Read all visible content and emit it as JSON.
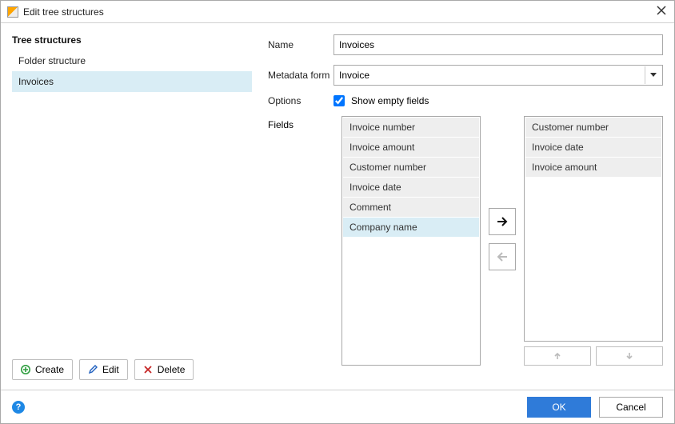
{
  "title": "Edit tree structures",
  "left": {
    "heading": "Tree structures",
    "items": [
      "Folder structure",
      "Invoices"
    ],
    "selected_index": 1,
    "buttons": {
      "create": "Create",
      "edit": "Edit",
      "delete": "Delete"
    }
  },
  "form": {
    "name_label": "Name",
    "name_value": "Invoices",
    "metadata_label": "Metadata form",
    "metadata_value": "Invoice",
    "options_label": "Options",
    "show_empty_checked": true,
    "show_empty_label": "Show empty fields",
    "fields_label": "Fields",
    "available_fields": [
      "Invoice number",
      "Invoice amount",
      "Customer number",
      "Invoice date",
      "Comment",
      "Company name"
    ],
    "available_selected_index": 5,
    "selected_fields": [
      "Customer number",
      "Invoice date",
      "Invoice amount"
    ]
  },
  "footer": {
    "ok": "OK",
    "cancel": "Cancel"
  }
}
